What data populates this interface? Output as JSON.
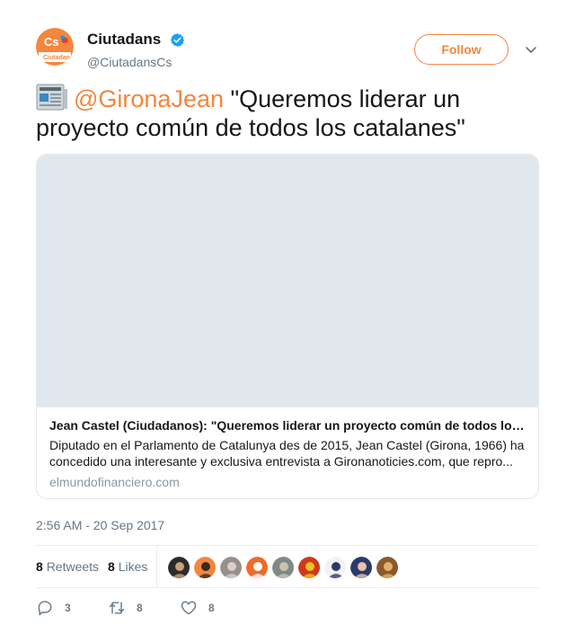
{
  "account": {
    "display_name": "Ciutadans",
    "handle": "@CiutadansCs",
    "verified": true,
    "brand_color": "#f4863e",
    "avatar_text": "Cs",
    "avatar_subtext": "Ciutadans"
  },
  "follow_button": {
    "label": "Follow"
  },
  "menu": {
    "icon": "chevron-down-icon"
  },
  "tweet": {
    "emoji_icon": "newspaper-icon",
    "mention": "@GironaJean",
    "text": " \"Queremos liderar un proyecto común de todos los catalanes\""
  },
  "card": {
    "title": "Jean Castel (Ciudadanos): \"Queremos liderar un proyecto común de todos los catalanes\"",
    "description": "Diputado en el Parlamento de Catalunya des de 2015, Jean Castel (Girona, 1966) ha concedido una interesante y exclusiva entrevista a Gironanoticies.com, que repro...",
    "domain": "elmundofinanciero.com"
  },
  "timestamp": "2:56 AM - 20 Sep 2017",
  "stats": {
    "retweets_count": "8",
    "retweets_label": "Retweets",
    "likes_count": "8",
    "likes_label": "Likes"
  },
  "likers": [
    {
      "color": "#2b2b2b",
      "accent": "#c7a17a"
    },
    {
      "color": "#f4863e",
      "accent": "#3a2a1c"
    },
    {
      "color": "#9a8f8a",
      "accent": "#d8d0cc"
    },
    {
      "color": "#f06a2a",
      "accent": "#ffffff"
    },
    {
      "color": "#7d8a86",
      "accent": "#c9c2b0"
    },
    {
      "color": "#cc3a1b",
      "accent": "#f1c21b"
    },
    {
      "color": "#f2f2f2",
      "accent": "#2b3a6b"
    },
    {
      "color": "#2b3a6b",
      "accent": "#e8c3a8"
    },
    {
      "color": "#8a5a2a",
      "accent": "#e2b26a"
    }
  ],
  "actions": {
    "reply_count": "3",
    "retweet_count": "8",
    "like_count": "8"
  }
}
